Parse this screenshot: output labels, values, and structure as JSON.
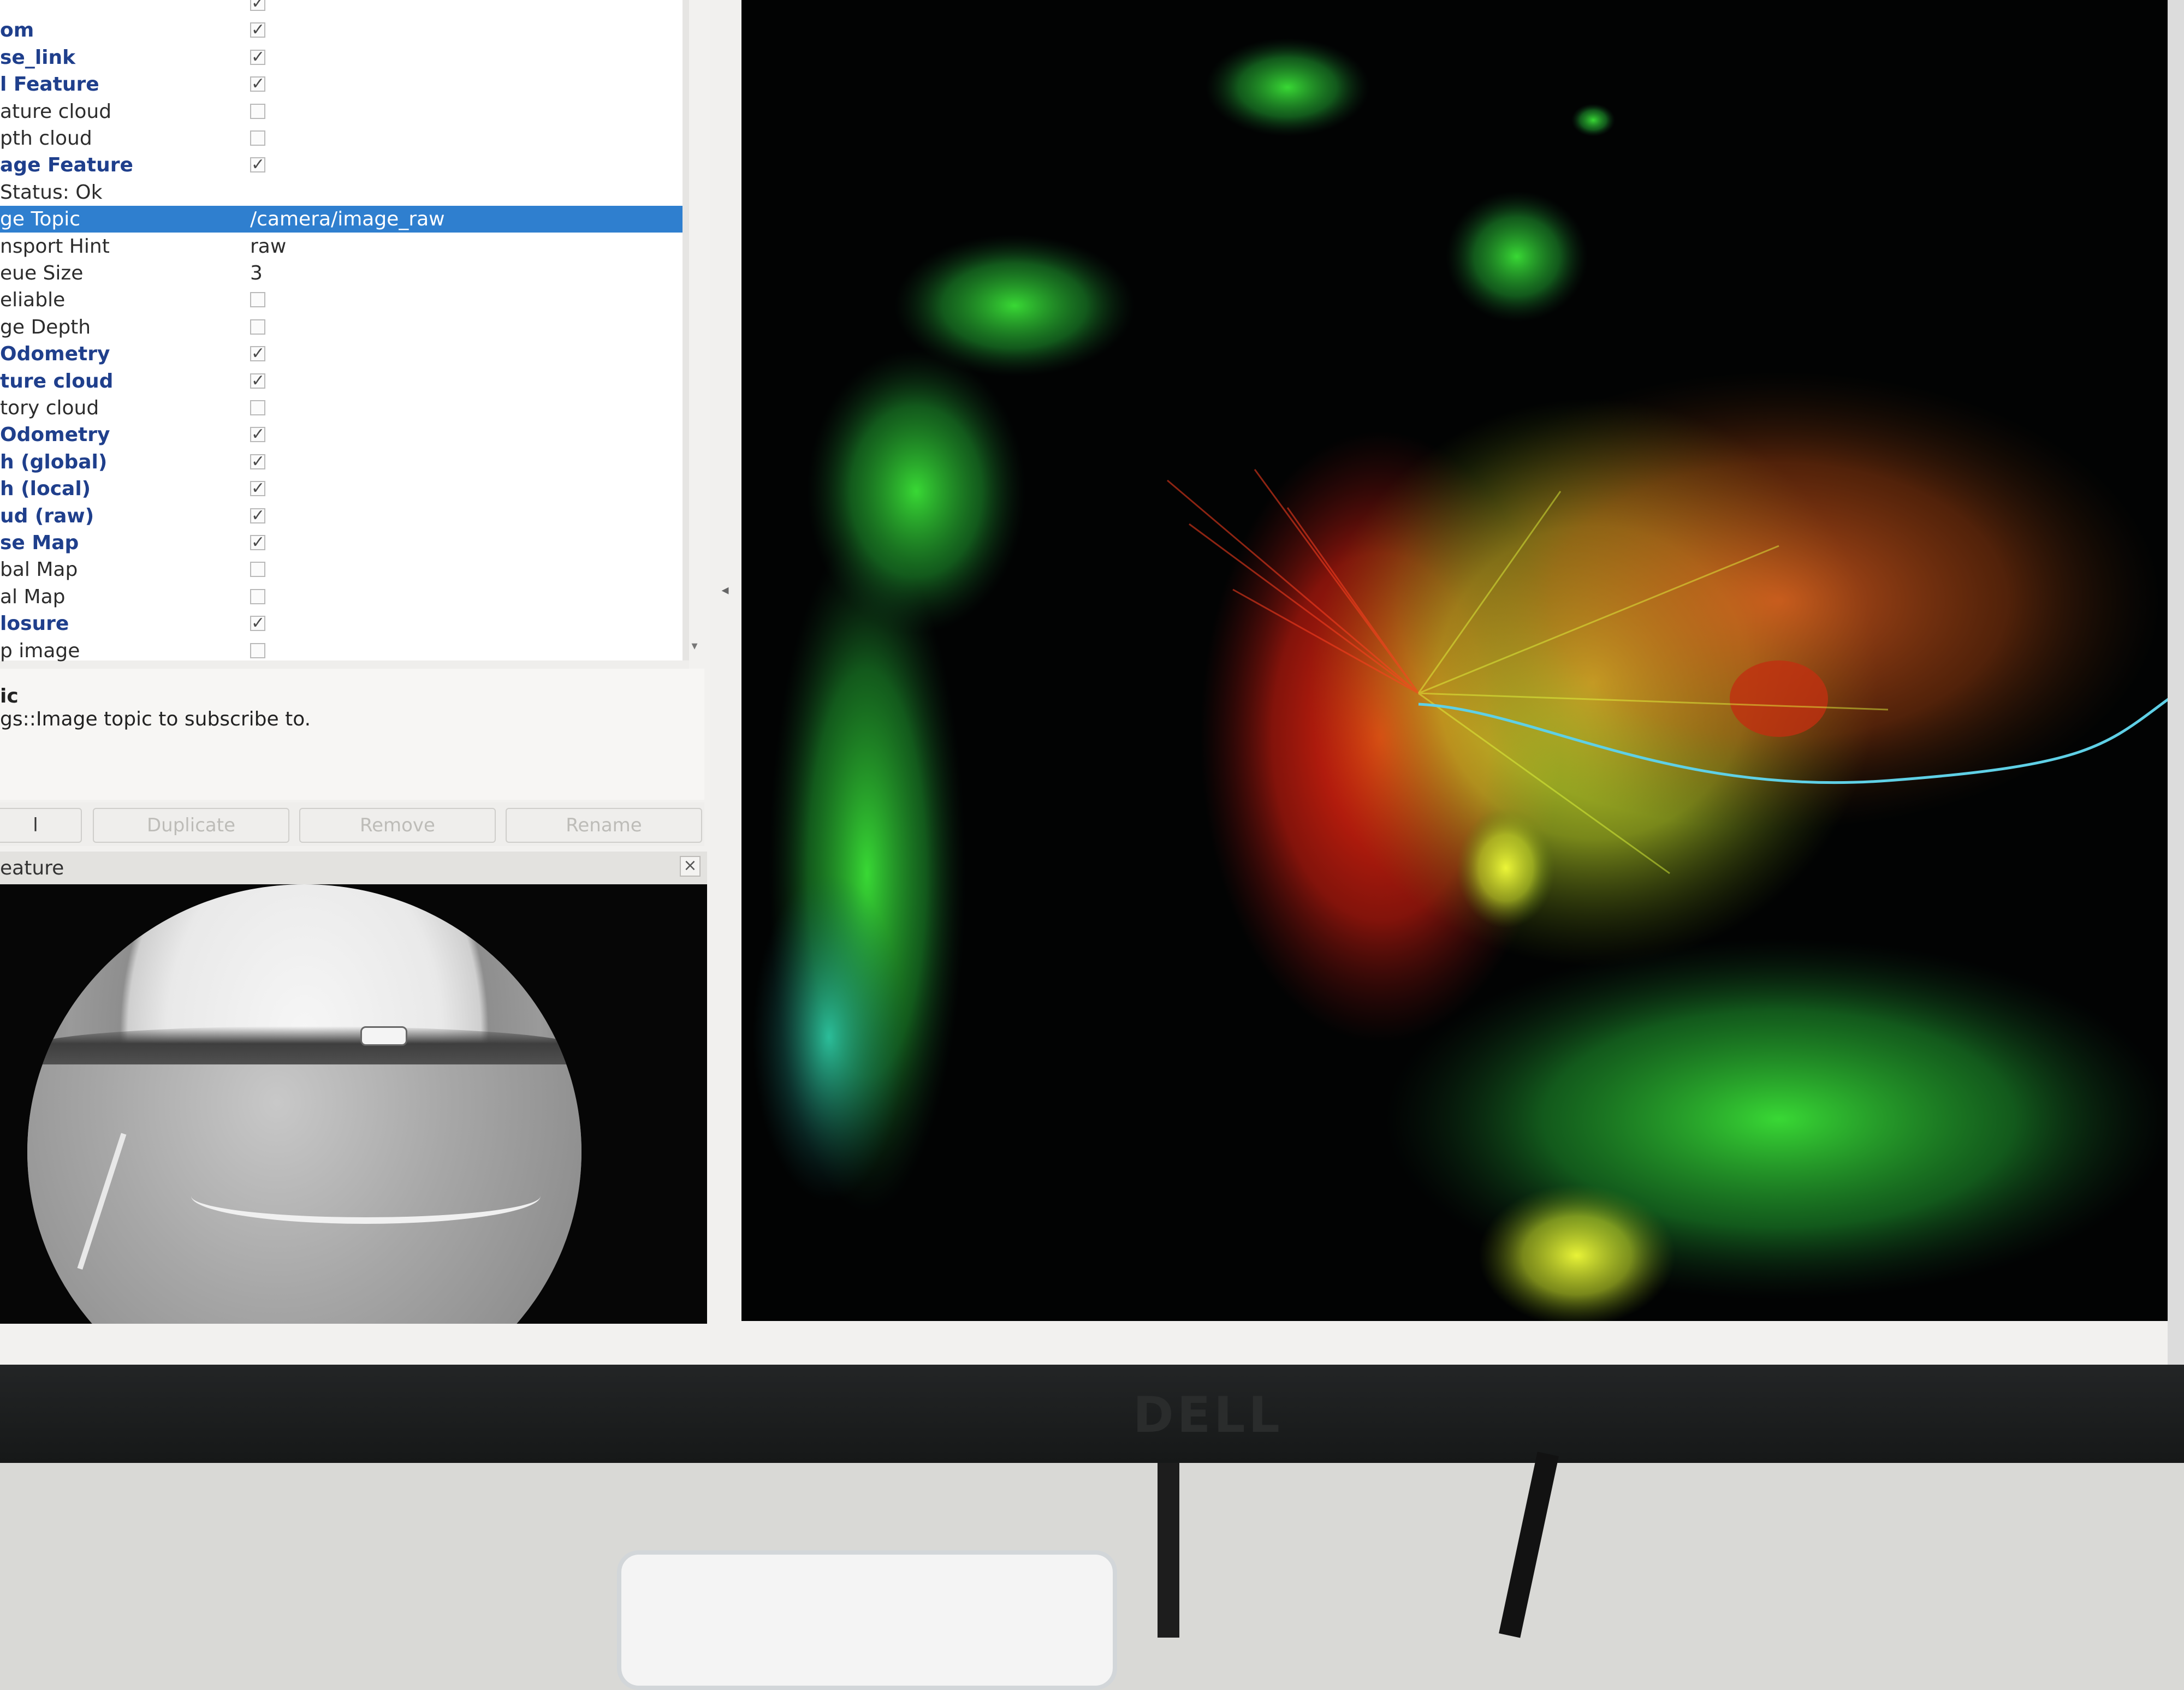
{
  "displays_tree": {
    "rows": [
      {
        "name": "",
        "type": "checkbox",
        "checked": true,
        "bold": false
      },
      {
        "name": "om",
        "type": "checkbox",
        "checked": true,
        "bold": true
      },
      {
        "name": "se_link",
        "type": "checkbox",
        "checked": true,
        "bold": true
      },
      {
        "name": "l Feature",
        "type": "checkbox",
        "checked": true,
        "bold": true
      },
      {
        "name": "ature cloud",
        "type": "checkbox",
        "checked": false,
        "bold": false
      },
      {
        "name": "pth cloud",
        "type": "checkbox",
        "checked": false,
        "bold": false
      },
      {
        "name": "age Feature",
        "type": "checkbox",
        "checked": true,
        "bold": true
      },
      {
        "name": "Status: Ok",
        "type": "text",
        "value": "",
        "bold": false
      },
      {
        "name": "ge Topic",
        "type": "text",
        "value": "/camera/image_raw",
        "selected": true
      },
      {
        "name": "nsport Hint",
        "type": "text",
        "value": "raw"
      },
      {
        "name": "eue Size",
        "type": "text",
        "value": "3"
      },
      {
        "name": "eliable",
        "type": "checkbox",
        "checked": false,
        "bold": false
      },
      {
        "name": "ge Depth",
        "type": "checkbox",
        "checked": false,
        "bold": false
      },
      {
        "name": " Odometry",
        "type": "checkbox",
        "checked": true,
        "bold": true
      },
      {
        "name": "ture cloud",
        "type": "checkbox",
        "checked": true,
        "bold": true
      },
      {
        "name": "tory cloud",
        "type": "checkbox",
        "checked": false,
        "bold": false
      },
      {
        "name": "Odometry",
        "type": "checkbox",
        "checked": true,
        "bold": true
      },
      {
        "name": "h (global)",
        "type": "checkbox",
        "checked": true,
        "bold": true
      },
      {
        "name": "h (local)",
        "type": "checkbox",
        "checked": true,
        "bold": true
      },
      {
        "name": "ud (raw)",
        "type": "checkbox",
        "checked": true,
        "bold": true
      },
      {
        "name": "se Map",
        "type": "checkbox",
        "checked": true,
        "bold": true
      },
      {
        "name": "bal Map",
        "type": "checkbox",
        "checked": false,
        "bold": false
      },
      {
        "name": "al Map",
        "type": "checkbox",
        "checked": false,
        "bold": false
      },
      {
        "name": "losure",
        "type": "checkbox",
        "checked": true,
        "bold": true
      },
      {
        "name": "p image",
        "type": "checkbox",
        "checked": false,
        "bold": false
      }
    ],
    "scroll_down_icon": "triangle-down"
  },
  "help": {
    "title": "ic",
    "text": "gs::Image topic to subscribe to."
  },
  "buttons": {
    "add": "l",
    "duplicate": "Duplicate",
    "remove": "Remove",
    "rename": "Rename"
  },
  "image_panel": {
    "title": "eature",
    "close_glyph": "×"
  },
  "splitter": {
    "handle_glyph": "◂"
  },
  "bezel": {
    "brand": "DELL"
  },
  "colors": {
    "selection": "#2f7fcf",
    "bold_name": "#1f3f8c",
    "view_background": "#020303"
  }
}
